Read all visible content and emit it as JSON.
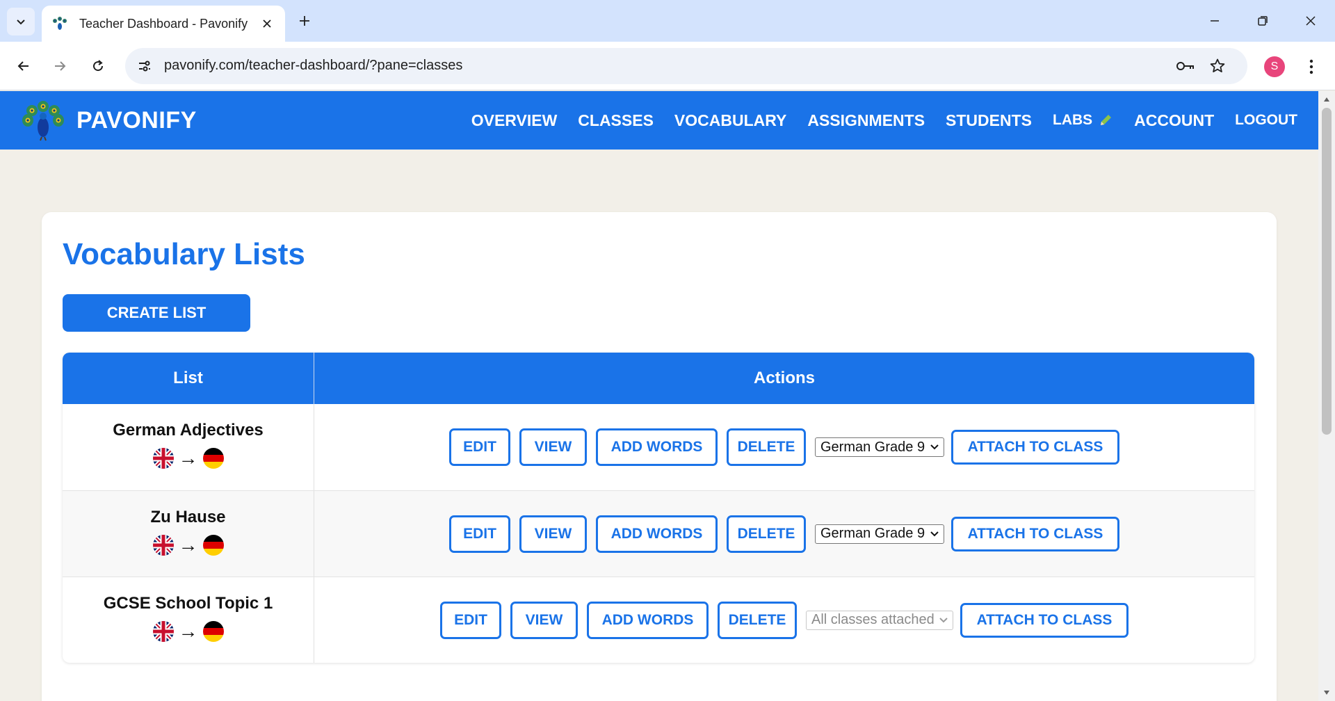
{
  "browser": {
    "tab_title": "Teacher Dashboard - Pavonify",
    "url": "pavonify.com/teacher-dashboard/?pane=classes",
    "profile_initial": "S",
    "icons": [
      "tab-search-icon",
      "close-icon",
      "plus-icon",
      "minimize-icon",
      "restore-icon",
      "close-window-icon",
      "back-icon",
      "forward-icon",
      "reload-icon",
      "site-info-icon",
      "password-key-icon",
      "star-icon",
      "more-vert-icon"
    ]
  },
  "site": {
    "brand": "PAVONIFY",
    "nav": [
      {
        "label": "OVERVIEW"
      },
      {
        "label": "CLASSES"
      },
      {
        "label": "VOCABULARY"
      },
      {
        "label": "ASSIGNMENTS"
      },
      {
        "label": "STUDENTS"
      },
      {
        "label": "LABS"
      },
      {
        "label": "ACCOUNT"
      },
      {
        "label": "LOGOUT"
      }
    ],
    "accent_color": "#1a73e8"
  },
  "main": {
    "title": "Vocabulary Lists",
    "create_label": "CREATE LIST",
    "table": {
      "headers": [
        "List",
        "Actions"
      ],
      "actions": {
        "edit": "EDIT",
        "view": "VIEW",
        "add": "ADD WORDS",
        "delete": "DELETE",
        "attach": "ATTACH TO CLASS"
      },
      "arrow": "→",
      "rows": [
        {
          "name": "German Adjectives",
          "source_flag": "uk-flag-icon",
          "target_flag": "germany-flag-icon",
          "class_select": "German Grade 9",
          "select_disabled": false
        },
        {
          "name": "Zu Hause",
          "source_flag": "uk-flag-icon",
          "target_flag": "germany-flag-icon",
          "class_select": "German Grade 9",
          "select_disabled": false
        },
        {
          "name": "GCSE School Topic 1",
          "source_flag": "uk-flag-icon",
          "target_flag": "germany-flag-icon",
          "class_select": "All classes attached",
          "select_disabled": true
        }
      ]
    }
  }
}
